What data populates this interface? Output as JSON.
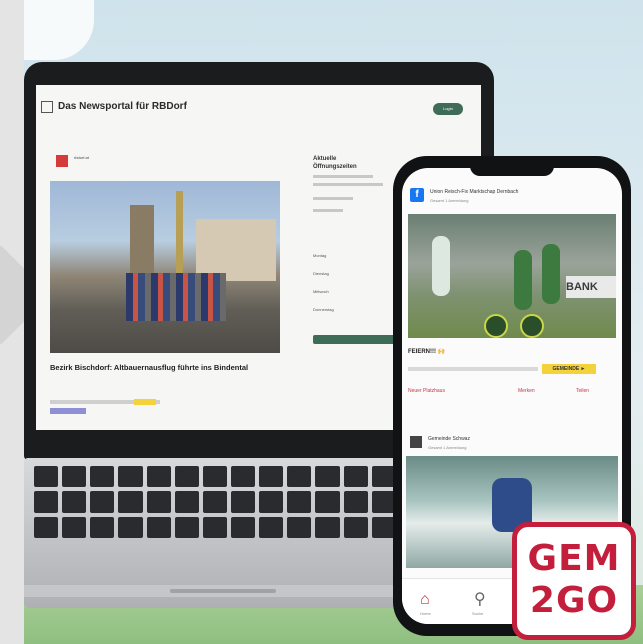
{
  "site": {
    "title": "Das Newsportal für RBDorf",
    "login_label": "Login"
  },
  "article": {
    "source": "rbdorf.at",
    "headline": "Bezirk Bischdorf: Altbauernausflug führte ins Bindental"
  },
  "sidebar": {
    "title_line1": "Aktuelle",
    "title_line2": "Öffnungszeiten",
    "rows": [
      "Montag",
      "Dienstag",
      "Mittwoch",
      "Donnerstag"
    ]
  },
  "phone_feed": {
    "post1": {
      "author": "Union Reisch-Fix Marktschap Dernbach",
      "subtitle": "Gesamt 1 Anmeldung"
    },
    "post1_image": {
      "banner_text": "BANK"
    },
    "reactions": "FEIERN!!! 🙌",
    "highlight_chip": "GEMEINDE ►",
    "actions": {
      "more": "Neuer Platzhaus",
      "share": "Merken",
      "comment": "Teilen"
    },
    "post2": {
      "author": "Gemeinde Schwaz",
      "subtitle": "Gesamt 1 Anmeldung"
    },
    "nav": {
      "home_label": "Home",
      "search_label": "Suche"
    }
  },
  "badge": {
    "line1": "GEM",
    "line2": "2GO"
  }
}
